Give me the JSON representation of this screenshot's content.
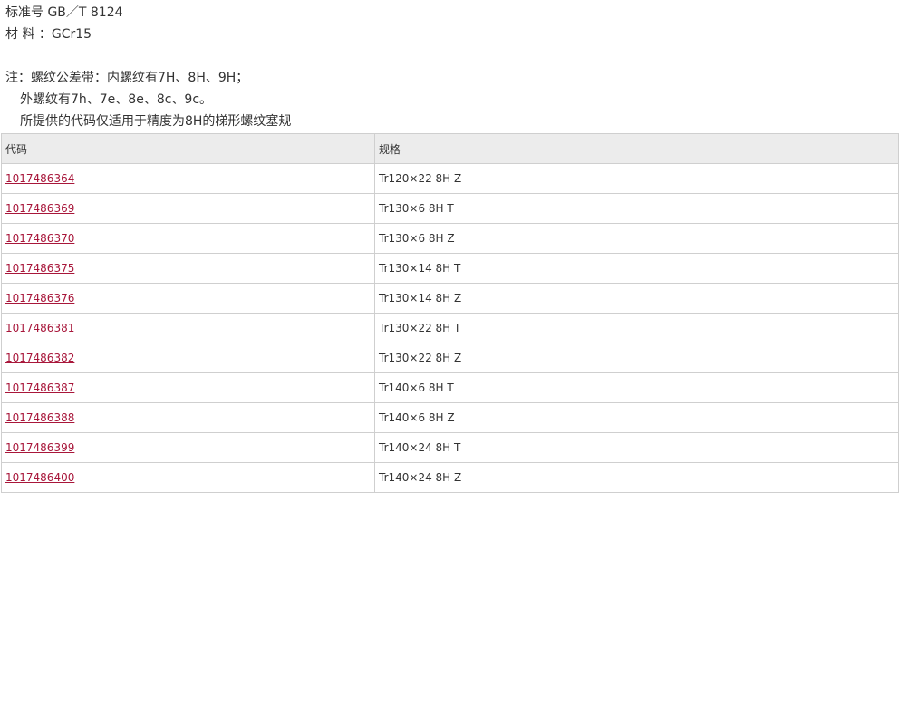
{
  "header": {
    "standard_line": "标准号 GB／T 8124",
    "material_line": "材  料 ：GCr15"
  },
  "notes": {
    "line1": "注：螺纹公差带：内螺纹有7H、8H、9H；",
    "line2": "外螺纹有7h、7e、8e、8c、9c。",
    "line3": "所提供的代码仅适用于精度为8H的梯形螺纹塞规"
  },
  "table": {
    "headers": [
      "代码",
      "规格"
    ],
    "rows": [
      {
        "code": "1017486364",
        "spec": "Tr120×22 8H Z"
      },
      {
        "code": "1017486369",
        "spec": "Tr130×6 8H T"
      },
      {
        "code": "1017486370",
        "spec": "Tr130×6 8H Z"
      },
      {
        "code": "1017486375",
        "spec": "Tr130×14 8H T"
      },
      {
        "code": "1017486376",
        "spec": "Tr130×14 8H Z"
      },
      {
        "code": "1017486381",
        "spec": "Tr130×22 8H T"
      },
      {
        "code": "1017486382",
        "spec": "Tr130×22 8H Z"
      },
      {
        "code": "1017486387",
        "spec": "Tr140×6 8H T"
      },
      {
        "code": "1017486388",
        "spec": "Tr140×6 8H Z"
      },
      {
        "code": "1017486399",
        "spec": "Tr140×24 8H T"
      },
      {
        "code": "1017486400",
        "spec": "Tr140×24 8H Z"
      }
    ]
  },
  "colors": {
    "link": "#a8163a",
    "header_bg": "#ececec",
    "border": "#cfcfcf",
    "text": "#333333"
  }
}
